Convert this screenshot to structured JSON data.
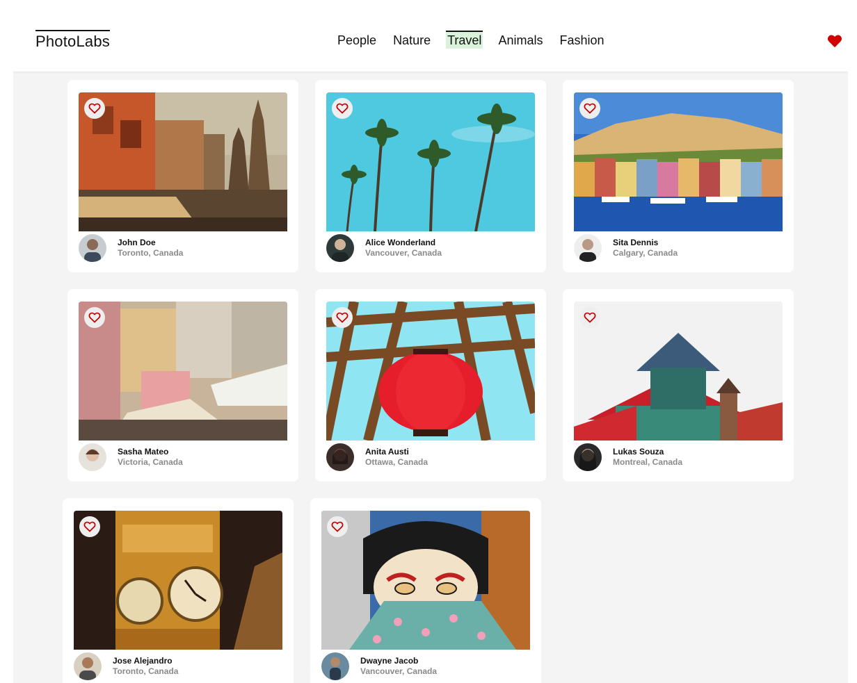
{
  "app": {
    "logo": "PhotoLabs",
    "topics": [
      "People",
      "Nature",
      "Travel",
      "Animals",
      "Fashion"
    ],
    "active_topic": "Travel",
    "fav_badge_icon": "heart-filled-icon",
    "fav_color": "#d00000"
  },
  "photos": [
    {
      "name": "John Doe",
      "location": "Toronto, Canada",
      "scene": "old-town-buildings"
    },
    {
      "name": "Alice Wonderland",
      "location": "Vancouver, Canada",
      "scene": "palm-trees-sky"
    },
    {
      "name": "Sita Dennis",
      "location": "Calgary, Canada",
      "scene": "harbor-town"
    },
    {
      "name": "Sasha Mateo",
      "location": "Victoria, Canada",
      "scene": "market-street"
    },
    {
      "name": "Anita Austi",
      "location": "Ottawa, Canada",
      "scene": "red-lantern"
    },
    {
      "name": "Lukas Souza",
      "location": "Montreal, Canada",
      "scene": "pagoda-roof"
    },
    {
      "name": "Jose Alejandro",
      "location": "Toronto, Canada",
      "scene": "clock-tower"
    },
    {
      "name": "Dwayne Jacob",
      "location": "Vancouver, Canada",
      "scene": "mural-geisha"
    }
  ]
}
